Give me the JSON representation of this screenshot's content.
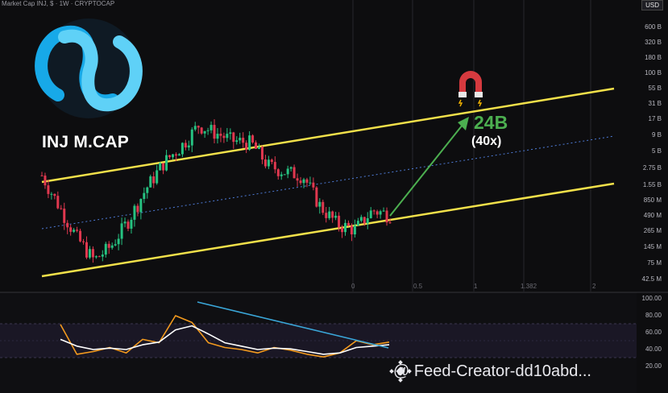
{
  "header": {
    "text": "Market Cap INJ, $ · 1W · CRYPTOCAP",
    "currency": "USD"
  },
  "title": "INJ M.CAP",
  "annotation": {
    "target": "24B",
    "multiple": "(40x)"
  },
  "watermark": "@ Feed-Creator-dd10abd...",
  "fib_labels": [
    "0",
    "0.5",
    "1",
    "1.382",
    "2"
  ],
  "price_axis": [
    "600 B",
    "320 B",
    "180 B",
    "100 B",
    "55 B",
    "31 B",
    "17 B",
    "9 B",
    "5 B",
    "2.75 B",
    "1.55 B",
    "850 M",
    "490 M",
    "265 M",
    "145 M",
    "75 M",
    "42.5 M"
  ],
  "osc_axis": [
    "100.00",
    "80.00",
    "60.00",
    "40.00",
    "20.00"
  ],
  "colors": {
    "channel": "#f1e04a",
    "mid": "#4e7bd6",
    "up": "#26c281",
    "down": "#e0384f",
    "arrow": "#4caf50",
    "trendline": "#3aa6d8",
    "osc_fast": "#f39a1e",
    "osc_slow": "#ffffff"
  },
  "chart_data": [
    {
      "type": "line",
      "series": [
        {
          "values": [
            1.2,
            0.6,
            0.3,
            0.18,
            0.25,
            0.45,
            0.9,
            1.6,
            2.3,
            3.7,
            3.1,
            2.6,
            2.5,
            1.5,
            1.3,
            1.2,
            0.6,
            0.4,
            0.36,
            0.55,
            0.5
          ]
        }
      ],
      "scale": "log"
    },
    {
      "type": "line",
      "series": [
        {
          "values": [
            82,
            38,
            42,
            48,
            40,
            60,
            55,
            95,
            85,
            55,
            48,
            45,
            40,
            48,
            44,
            38,
            34,
            40,
            58,
            52,
            56
          ]
        },
        {
          "values": [
            60,
            50,
            45,
            47,
            45,
            52,
            56,
            74,
            80,
            68,
            55,
            50,
            45,
            47,
            46,
            42,
            38,
            40,
            48,
            50,
            52
          ]
        }
      ],
      "ylim": [
        0,
        100
      ]
    }
  ]
}
